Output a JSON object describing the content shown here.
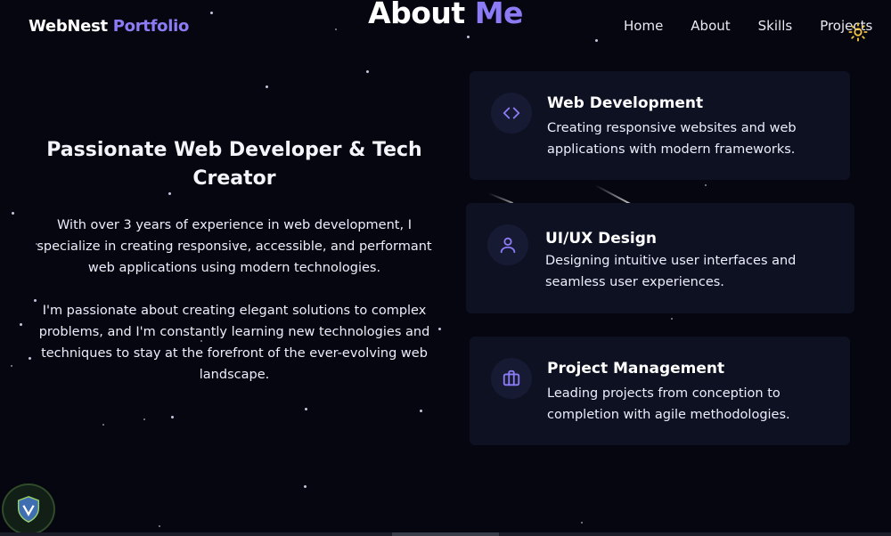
{
  "brand": {
    "name": "WebNest",
    "accent": "Portfolio",
    "accent_color": "#8b7cf6"
  },
  "nav": {
    "items": [
      "Home",
      "About",
      "Skills",
      "Projects"
    ]
  },
  "theme_toggle": {
    "icon": "sun-icon",
    "color": "#f5c542"
  },
  "section": {
    "title_main": "About",
    "title_accent": "Me"
  },
  "about": {
    "heading": "Passionate Web Developer & Tech Creator",
    "paragraphs": [
      "With over 3 years of experience in web development, I specialize in creating responsive, accessible, and performant web applications using modern technologies.",
      "I'm passionate about creating elegant solutions to complex problems, and I'm constantly learning new technologies and techniques to stay at the forefront of the ever-evolving web landscape."
    ]
  },
  "cards": [
    {
      "icon": "code-icon",
      "title": "Web Development",
      "description": "Creating responsive websites and web applications with modern frameworks."
    },
    {
      "icon": "user-icon",
      "title": "UI/UX Design",
      "description": "Designing intuitive user interfaces and seamless user experiences."
    },
    {
      "icon": "briefcase-icon",
      "title": "Project Management",
      "description": "Leading projects from conception to completion with agile methodologies."
    }
  ],
  "colors": {
    "background": "#05060f",
    "card": "#0d1122",
    "icon_color": "#8b7cf6"
  }
}
